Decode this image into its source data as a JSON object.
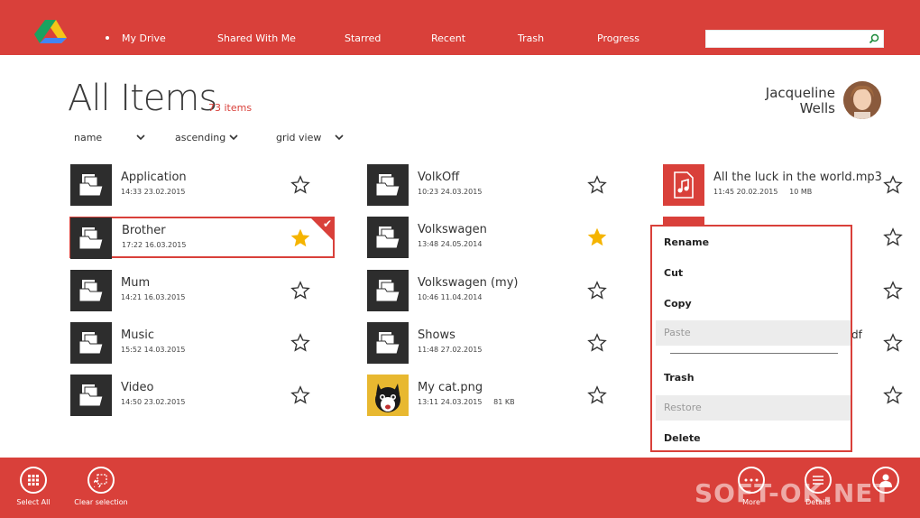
{
  "nav": {
    "items": [
      "My Drive",
      "Shared With Me",
      "Starred",
      "Recent",
      "Trash",
      "Progress"
    ],
    "search_placeholder": ""
  },
  "header": {
    "title": "All Items",
    "count": "73 items",
    "user_first": "Jacqueline",
    "user_last": "Wells"
  },
  "sort": {
    "field": "name",
    "order": "ascending",
    "view": "grid view"
  },
  "files": {
    "col1": [
      {
        "name": "Application",
        "meta": "14:33 23.02.2015",
        "starred": false
      },
      {
        "name": "Brother",
        "meta": "17:22 16.03.2015",
        "starred": true,
        "selected": true
      },
      {
        "name": "Mum",
        "meta": "14:21 16.03.2015",
        "starred": false
      },
      {
        "name": "Music",
        "meta": "15:52 14.03.2015",
        "starred": false
      },
      {
        "name": "Video",
        "meta": "14:50 23.02.2015",
        "starred": false
      }
    ],
    "col2": [
      {
        "name": "VolkOff",
        "meta": "10:23 24.03.2015",
        "starred": false
      },
      {
        "name": "Volkswagen",
        "meta": "13:48 24.05.2014",
        "starred": true
      },
      {
        "name": "Volkswagen (my)",
        "meta": "10:46 11.04.2014",
        "starred": false
      },
      {
        "name": "Shows",
        "meta": "11:48 27.02.2015",
        "starred": false
      },
      {
        "name": "My cat.png",
        "meta": "13:11 24.03.2015     81 KB",
        "starred": false
      }
    ],
    "col3": [
      {
        "name": "All the luck in the world.mp3",
        "meta": "11:45 20.02.2015     10 MB",
        "starred": false
      }
    ],
    "partial_text": "df"
  },
  "context_menu": {
    "items": [
      "Rename",
      "Cut",
      "Copy",
      "Paste",
      "Trash",
      "Restore",
      "Delete"
    ]
  },
  "bottom": {
    "select_all": "Select All",
    "clear_selection": "Clear selection",
    "more": "More",
    "details": "Details"
  },
  "watermark": "SOFT-OK.NET",
  "colors": {
    "accent": "#d9403a",
    "tile_dark": "#2d2d2d",
    "star_active": "#f5b400"
  }
}
